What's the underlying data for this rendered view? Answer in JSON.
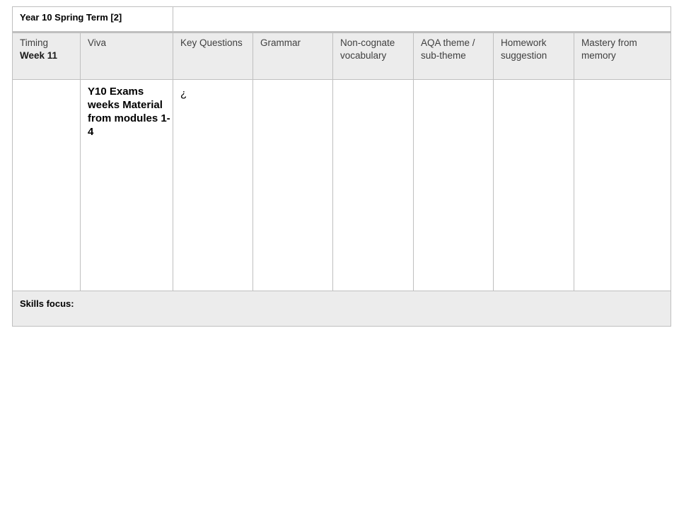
{
  "document": {
    "title": "Year 10 Spring Term [2]",
    "columns": [
      {
        "label": "Timing",
        "sub": "Week 11"
      },
      {
        "label": "Viva"
      },
      {
        "label": "Key Questions"
      },
      {
        "label": "Grammar"
      },
      {
        "label": "Non-cognate vocabulary"
      },
      {
        "label": "AQA theme / sub-theme"
      },
      {
        "label": "Homework suggestion"
      },
      {
        "label": "Mastery from memory"
      }
    ],
    "content": {
      "timing": "",
      "viva": "Y10 Exams weeks Material from modules 1-4",
      "key_questions": "¿",
      "grammar": "",
      "non_cognate_vocabulary": "",
      "aqa_theme": "",
      "homework": "",
      "mastery": ""
    },
    "skills_focus_label": "Skills focus:"
  }
}
